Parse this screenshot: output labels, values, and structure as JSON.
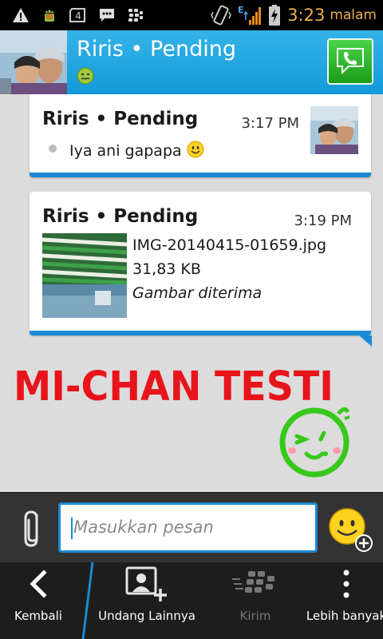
{
  "status_bar": {
    "time": "3:23",
    "ampm": "malam",
    "notification_badge": "4",
    "network": "E",
    "icons": [
      "warning-icon",
      "android-icon",
      "sim-icon",
      "bbm-chat-icon",
      "bbm-icon",
      "vibrate-icon",
      "signal-icon",
      "battery-charging-icon"
    ]
  },
  "header": {
    "title": "Riris • Pending",
    "status_icon": "sick-emoticon-icon",
    "call_icon": "phone-call-icon",
    "color": "#1fa6e0"
  },
  "messages": [
    {
      "sender": "Riris • Pending",
      "time": "3:17 PM",
      "text": "Iya ani gapapa",
      "emoticon": "smile-emoticon-icon"
    },
    {
      "sender": "Riris • Pending",
      "time": "3:19 PM",
      "file_name": "IMG-20140415-01659.jpg",
      "file_size": "31,83 KB",
      "file_status": "Gambar diterima"
    }
  ],
  "watermark": {
    "text": "MI-CHAN TESTI",
    "color": "#e8141b",
    "face_color": "#37c81b"
  },
  "compose": {
    "placeholder": "Masukkan pesan",
    "accent": "#1b8ad2"
  },
  "bottom_bar": {
    "items": [
      {
        "label": "Kembali",
        "icon": "back-chevron-icon"
      },
      {
        "label": "Undang Lainnya",
        "icon": "invite-contact-icon"
      },
      {
        "label": "Kirim",
        "icon": "send-bbm-icon"
      },
      {
        "label": "Lebih banyak",
        "icon": "overflow-menu-icon"
      }
    ]
  }
}
